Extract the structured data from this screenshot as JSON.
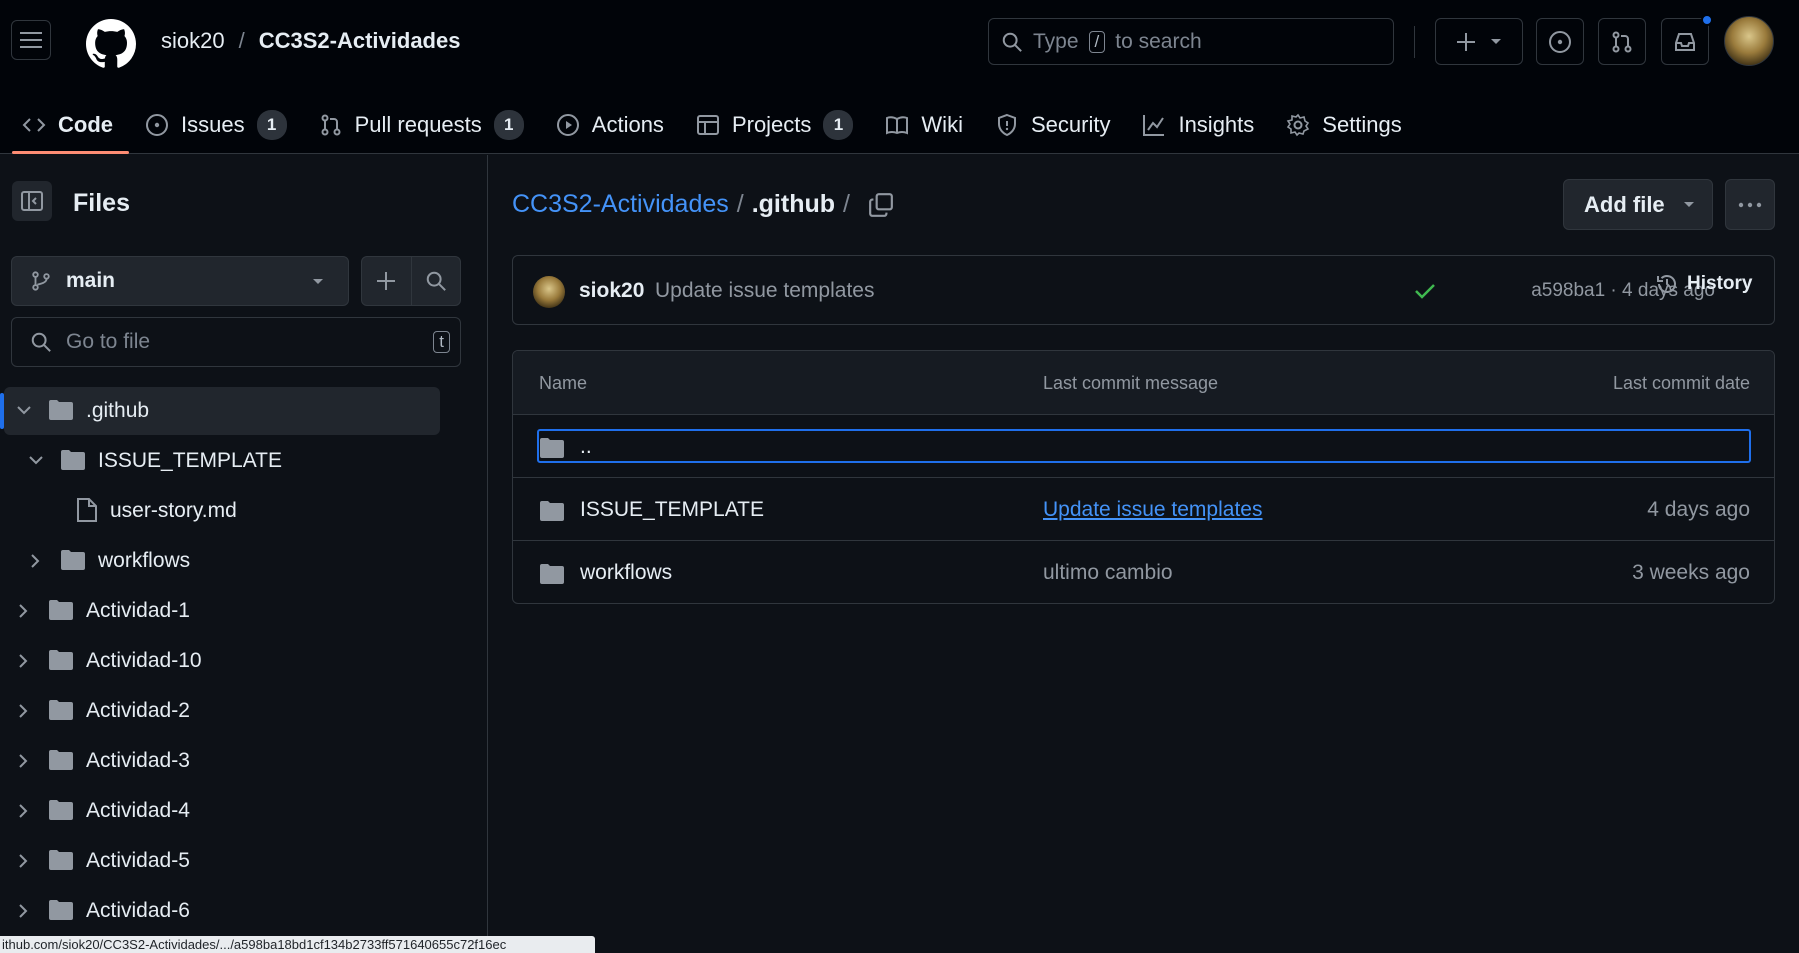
{
  "header": {
    "owner": "siok20",
    "separator": "/",
    "repo": "CC3S2-Actividades",
    "search": {
      "prefix": "Type",
      "key": "/",
      "suffix": "to search"
    }
  },
  "nav": {
    "code": "Code",
    "issues": "Issues",
    "issues_count": "1",
    "pulls": "Pull requests",
    "pulls_count": "1",
    "actions": "Actions",
    "projects": "Projects",
    "projects_count": "1",
    "wiki": "Wiki",
    "security": "Security",
    "insights": "Insights",
    "settings": "Settings"
  },
  "sidebar": {
    "title": "Files",
    "branch": "main",
    "goto_placeholder": "Go to file",
    "goto_key": "t",
    "tree": [
      {
        "label": ".github"
      },
      {
        "label": "ISSUE_TEMPLATE"
      },
      {
        "label": "user-story.md"
      },
      {
        "label": "workflows"
      },
      {
        "label": "Actividad-1"
      },
      {
        "label": "Actividad-10"
      },
      {
        "label": "Actividad-2"
      },
      {
        "label": "Actividad-3"
      },
      {
        "label": "Actividad-4"
      },
      {
        "label": "Actividad-5"
      },
      {
        "label": "Actividad-6"
      }
    ]
  },
  "main": {
    "breadcrumb": {
      "repo": "CC3S2-Actividades",
      "current": ".github",
      "slash": "/"
    },
    "add_file": "Add file",
    "commit": {
      "user": "siok20",
      "message": "Update issue templates",
      "meta": "a598ba1 · 4 days ago",
      "history": "History"
    },
    "table": {
      "headers": {
        "name": "Name",
        "message": "Last commit message",
        "date": "Last commit date"
      },
      "parent": "..",
      "rows": [
        {
          "name": "ISSUE_TEMPLATE",
          "message": "Update issue templates",
          "date": "4 days ago"
        },
        {
          "name": "workflows",
          "message": "ultimo cambio",
          "date": "3 weeks ago"
        }
      ]
    }
  },
  "statusbar": "ithub.com/siok20/CC3S2-Actividades/.../a598ba18bd1cf134b2733ff571640655c72f16ec",
  "colors": {
    "accent": "#4493f8",
    "underline": "#fd8c73",
    "focus": "#1f6feb",
    "success": "#3fb950"
  }
}
